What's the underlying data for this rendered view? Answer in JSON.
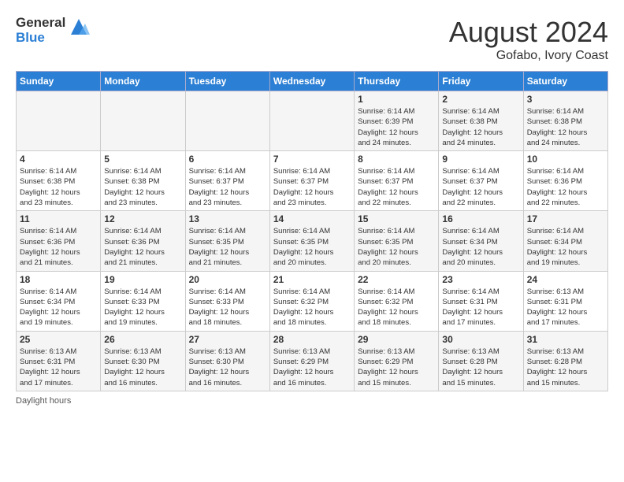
{
  "logo": {
    "line1": "General",
    "line2": "Blue"
  },
  "title": "August 2024",
  "subtitle": "Gofabo, Ivory Coast",
  "days_of_week": [
    "Sunday",
    "Monday",
    "Tuesday",
    "Wednesday",
    "Thursday",
    "Friday",
    "Saturday"
  ],
  "footer": "Daylight hours",
  "weeks": [
    [
      {
        "day": "",
        "info": ""
      },
      {
        "day": "",
        "info": ""
      },
      {
        "day": "",
        "info": ""
      },
      {
        "day": "",
        "info": ""
      },
      {
        "day": "1",
        "info": "Sunrise: 6:14 AM\nSunset: 6:39 PM\nDaylight: 12 hours\nand 24 minutes."
      },
      {
        "day": "2",
        "info": "Sunrise: 6:14 AM\nSunset: 6:38 PM\nDaylight: 12 hours\nand 24 minutes."
      },
      {
        "day": "3",
        "info": "Sunrise: 6:14 AM\nSunset: 6:38 PM\nDaylight: 12 hours\nand 24 minutes."
      }
    ],
    [
      {
        "day": "4",
        "info": "Sunrise: 6:14 AM\nSunset: 6:38 PM\nDaylight: 12 hours\nand 23 minutes."
      },
      {
        "day": "5",
        "info": "Sunrise: 6:14 AM\nSunset: 6:38 PM\nDaylight: 12 hours\nand 23 minutes."
      },
      {
        "day": "6",
        "info": "Sunrise: 6:14 AM\nSunset: 6:37 PM\nDaylight: 12 hours\nand 23 minutes."
      },
      {
        "day": "7",
        "info": "Sunrise: 6:14 AM\nSunset: 6:37 PM\nDaylight: 12 hours\nand 23 minutes."
      },
      {
        "day": "8",
        "info": "Sunrise: 6:14 AM\nSunset: 6:37 PM\nDaylight: 12 hours\nand 22 minutes."
      },
      {
        "day": "9",
        "info": "Sunrise: 6:14 AM\nSunset: 6:37 PM\nDaylight: 12 hours\nand 22 minutes."
      },
      {
        "day": "10",
        "info": "Sunrise: 6:14 AM\nSunset: 6:36 PM\nDaylight: 12 hours\nand 22 minutes."
      }
    ],
    [
      {
        "day": "11",
        "info": "Sunrise: 6:14 AM\nSunset: 6:36 PM\nDaylight: 12 hours\nand 21 minutes."
      },
      {
        "day": "12",
        "info": "Sunrise: 6:14 AM\nSunset: 6:36 PM\nDaylight: 12 hours\nand 21 minutes."
      },
      {
        "day": "13",
        "info": "Sunrise: 6:14 AM\nSunset: 6:35 PM\nDaylight: 12 hours\nand 21 minutes."
      },
      {
        "day": "14",
        "info": "Sunrise: 6:14 AM\nSunset: 6:35 PM\nDaylight: 12 hours\nand 20 minutes."
      },
      {
        "day": "15",
        "info": "Sunrise: 6:14 AM\nSunset: 6:35 PM\nDaylight: 12 hours\nand 20 minutes."
      },
      {
        "day": "16",
        "info": "Sunrise: 6:14 AM\nSunset: 6:34 PM\nDaylight: 12 hours\nand 20 minutes."
      },
      {
        "day": "17",
        "info": "Sunrise: 6:14 AM\nSunset: 6:34 PM\nDaylight: 12 hours\nand 19 minutes."
      }
    ],
    [
      {
        "day": "18",
        "info": "Sunrise: 6:14 AM\nSunset: 6:34 PM\nDaylight: 12 hours\nand 19 minutes."
      },
      {
        "day": "19",
        "info": "Sunrise: 6:14 AM\nSunset: 6:33 PM\nDaylight: 12 hours\nand 19 minutes."
      },
      {
        "day": "20",
        "info": "Sunrise: 6:14 AM\nSunset: 6:33 PM\nDaylight: 12 hours\nand 18 minutes."
      },
      {
        "day": "21",
        "info": "Sunrise: 6:14 AM\nSunset: 6:32 PM\nDaylight: 12 hours\nand 18 minutes."
      },
      {
        "day": "22",
        "info": "Sunrise: 6:14 AM\nSunset: 6:32 PM\nDaylight: 12 hours\nand 18 minutes."
      },
      {
        "day": "23",
        "info": "Sunrise: 6:14 AM\nSunset: 6:31 PM\nDaylight: 12 hours\nand 17 minutes."
      },
      {
        "day": "24",
        "info": "Sunrise: 6:13 AM\nSunset: 6:31 PM\nDaylight: 12 hours\nand 17 minutes."
      }
    ],
    [
      {
        "day": "25",
        "info": "Sunrise: 6:13 AM\nSunset: 6:31 PM\nDaylight: 12 hours\nand 17 minutes."
      },
      {
        "day": "26",
        "info": "Sunrise: 6:13 AM\nSunset: 6:30 PM\nDaylight: 12 hours\nand 16 minutes."
      },
      {
        "day": "27",
        "info": "Sunrise: 6:13 AM\nSunset: 6:30 PM\nDaylight: 12 hours\nand 16 minutes."
      },
      {
        "day": "28",
        "info": "Sunrise: 6:13 AM\nSunset: 6:29 PM\nDaylight: 12 hours\nand 16 minutes."
      },
      {
        "day": "29",
        "info": "Sunrise: 6:13 AM\nSunset: 6:29 PM\nDaylight: 12 hours\nand 15 minutes."
      },
      {
        "day": "30",
        "info": "Sunrise: 6:13 AM\nSunset: 6:28 PM\nDaylight: 12 hours\nand 15 minutes."
      },
      {
        "day": "31",
        "info": "Sunrise: 6:13 AM\nSunset: 6:28 PM\nDaylight: 12 hours\nand 15 minutes."
      }
    ]
  ]
}
